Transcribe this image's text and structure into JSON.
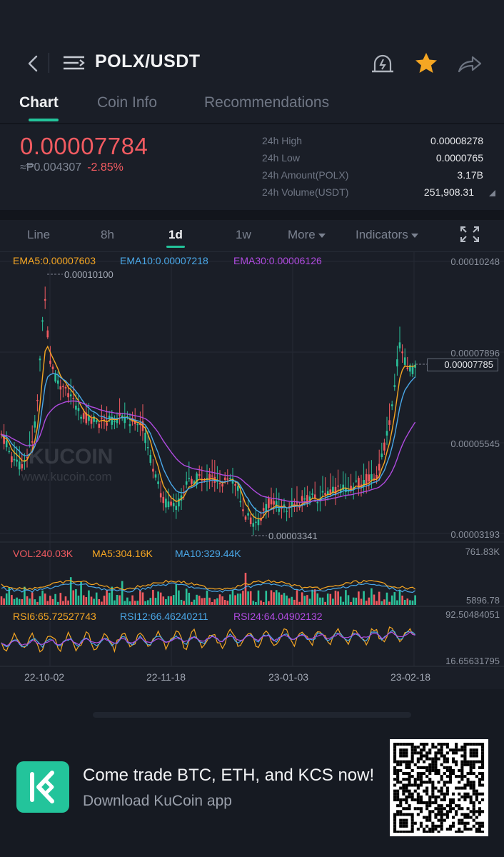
{
  "header": {
    "pair": "POLX/USDT"
  },
  "tabs": [
    {
      "label": "Chart",
      "active": true
    },
    {
      "label": "Coin Info",
      "active": false
    },
    {
      "label": "Recommendations",
      "active": false
    }
  ],
  "ticker": {
    "price": "0.00007784",
    "fiat": "≈₱0.004307",
    "change": "-2.85%",
    "stats": [
      {
        "label": "24h High",
        "value": "0.00008278"
      },
      {
        "label": "24h Low",
        "value": "0.0000765"
      },
      {
        "label": "24h Amount(POLX)",
        "value": "3.17B"
      },
      {
        "label": "24h Volume(USDT)",
        "value": "251,908.31"
      }
    ]
  },
  "timeframes": {
    "line": "Line",
    "h8": "8h",
    "d1": "1d",
    "w1": "1w",
    "more": "More",
    "indicators": "Indicators",
    "active": "1d"
  },
  "legends": {
    "ema5": "EMA5:0.00007603",
    "ema10": "EMA10:0.00007218",
    "ema30": "EMA30:0.00006126",
    "vol": "VOL:240.03K",
    "ma5": "MA5:304.16K",
    "ma10": "MA10:329.44K",
    "rsi6": "RSI6:65.72527743",
    "rsi12": "RSI12:66.46240211",
    "rsi24": "RSI24:64.04902132"
  },
  "axes": {
    "price": [
      "0.00010248",
      "0.00007896",
      "0.00005545",
      "0.00003193"
    ],
    "current": "0.00007785",
    "max_label": "0.00010100",
    "min_label": "0.00003341",
    "vol": [
      "761.83K",
      "5896.78"
    ],
    "rsi": [
      "92.50484051",
      "16.65631795"
    ],
    "dates": [
      "22-10-02",
      "22-11-18",
      "23-01-03",
      "23-02-18"
    ]
  },
  "watermark": {
    "brand": "KUCOIN",
    "url": "www.kucoin.com"
  },
  "banner": {
    "headline": "Come trade BTC, ETH, and KCS now!",
    "subline": "Download KuCoin app"
  },
  "colors": {
    "up": "#2bc19a",
    "down": "#f25b61",
    "accent": "#23c49b",
    "ema5": "#f5a623",
    "ema10": "#4aa8e8",
    "ema30": "#b04be0"
  },
  "icons": [
    "back-icon",
    "menu-icon",
    "alert-icon",
    "star-icon",
    "share-icon",
    "fullscreen-icon",
    "caret-down-icon",
    "kucoin-logo-icon",
    "qr-code"
  ]
}
